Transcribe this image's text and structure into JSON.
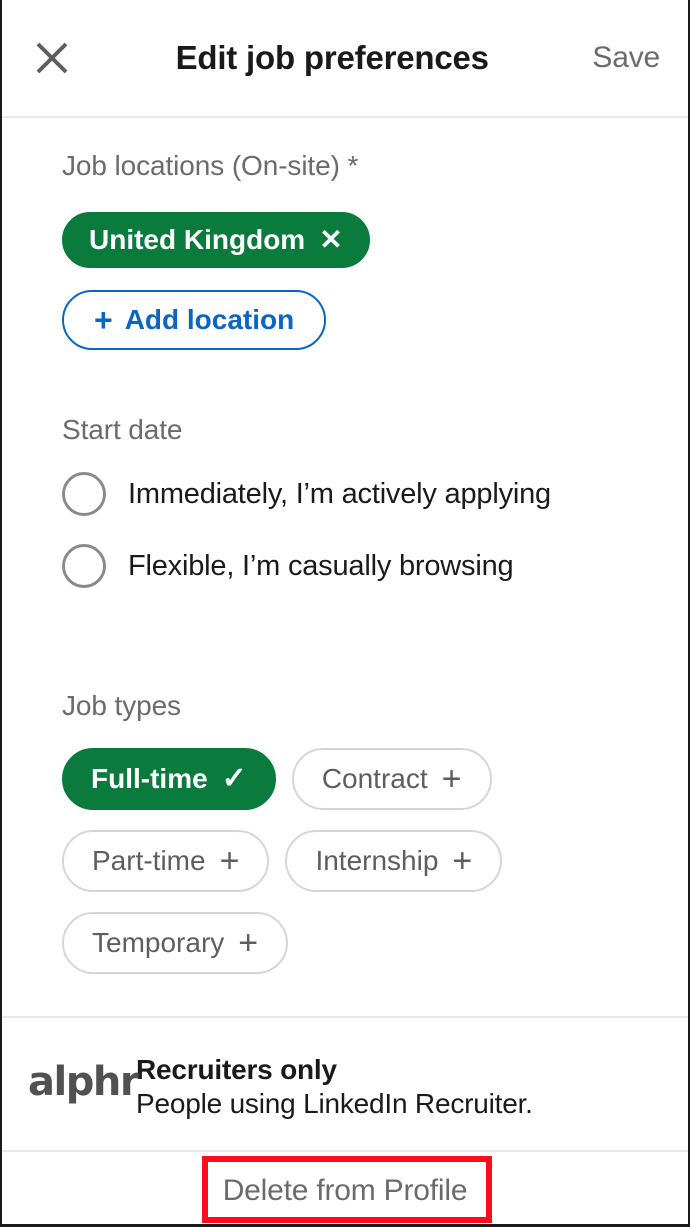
{
  "header": {
    "close_icon": "close-icon",
    "title": "Edit job preferences",
    "save_label": "Save"
  },
  "job_locations": {
    "label": "Job locations (On-site) *",
    "chips": [
      {
        "label": "United Kingdom",
        "glyph": "✕",
        "state": "selected"
      }
    ],
    "add_button": {
      "glyph": "+",
      "label": "Add location"
    }
  },
  "start_date": {
    "label": "Start date",
    "options": [
      {
        "label": "Immediately, I’m actively applying",
        "selected": false
      },
      {
        "label": "Flexible, I’m casually browsing",
        "selected": false
      }
    ]
  },
  "job_types": {
    "label": "Job types",
    "rows": [
      [
        {
          "label": "Full-time",
          "glyph": "✓",
          "state": "selected"
        },
        {
          "label": "Contract",
          "glyph": "+",
          "state": "unselected"
        }
      ],
      [
        {
          "label": "Part-time",
          "glyph": "+",
          "state": "unselected"
        },
        {
          "label": "Internship",
          "glyph": "+",
          "state": "unselected"
        }
      ],
      [
        {
          "label": "Temporary",
          "glyph": "+",
          "state": "unselected"
        }
      ]
    ]
  },
  "recruiters": {
    "watermark": "alphr",
    "title": "Recruiters only",
    "subtitle": "People using LinkedIn Recruiter."
  },
  "footer": {
    "delete_label": "Delete from Profile"
  },
  "colors": {
    "selected_green": "#0a7a3d",
    "link_blue": "#0a66c2",
    "highlight_red": "#fc0d1b",
    "muted_text": "#6b6b6b",
    "chip_border": "#d6d6d6"
  }
}
